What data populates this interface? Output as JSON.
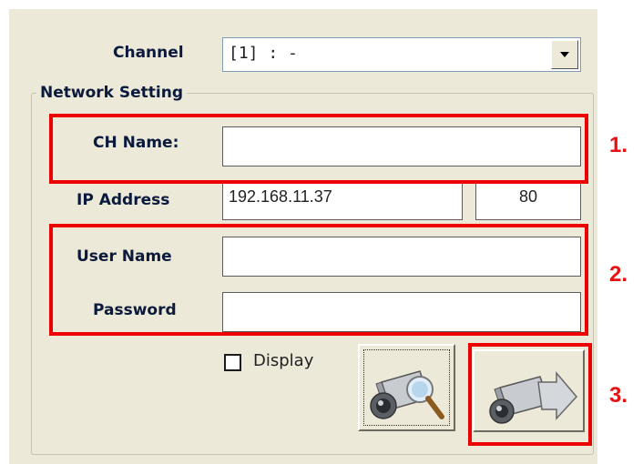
{
  "channel": {
    "label": "Channel",
    "value": "[1] : -"
  },
  "network_setting": {
    "title": "Network Setting",
    "ch_name": {
      "label": "CH Name:",
      "value": ""
    },
    "ip_address": {
      "label": "IP Address",
      "value": "192.168.11.37",
      "port": "80"
    },
    "user_name": {
      "label": "User Name",
      "value": ""
    },
    "password": {
      "label": "Password",
      "value": ""
    },
    "display": {
      "label": "Display",
      "checked": false
    }
  },
  "callouts": {
    "one": "1.",
    "two": "2.",
    "three": "3."
  },
  "icons": {
    "search_camera": "camera-search-icon",
    "connect_camera": "camera-arrow-icon"
  },
  "colors": {
    "callout": "#ee0000",
    "panel_bg": "#ece9d8"
  }
}
